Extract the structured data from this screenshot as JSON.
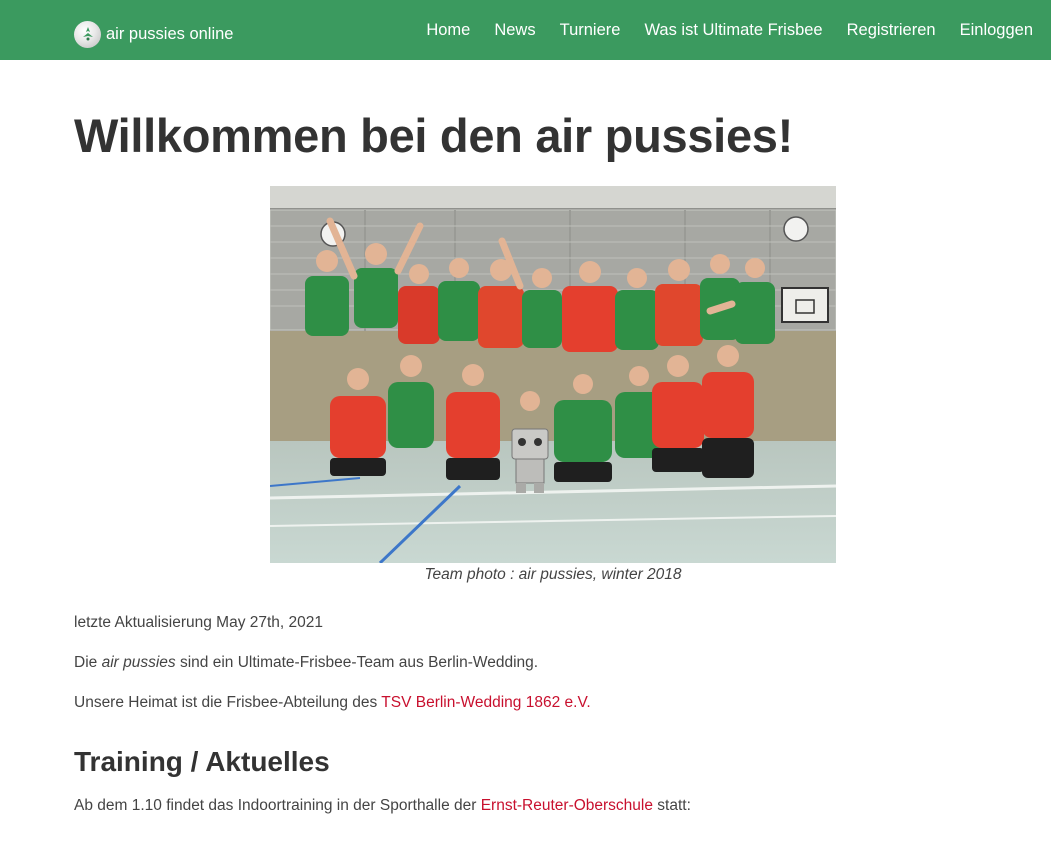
{
  "navbar": {
    "brand_label": "air pussies online",
    "items": [
      {
        "label": "Home"
      },
      {
        "label": "News"
      },
      {
        "label": "Turniere"
      },
      {
        "label": "Was ist Ultimate Frisbee"
      },
      {
        "label": "Registrieren"
      },
      {
        "label": "Einloggen"
      }
    ],
    "color": "#3b9a5f"
  },
  "main": {
    "title": "Willkommen bei den air pussies!",
    "photo_caption": "Team photo : air pussies, winter 2018",
    "last_update": "letzte Aktualisierung May 27th, 2021",
    "intro": {
      "before": "Die ",
      "team_name": "air pussies",
      "after": " sind ein Ultimate-Frisbee-Team aus Berlin-Wedding."
    },
    "home": {
      "before": "Unsere Heimat ist die Frisbee-Abteilung des ",
      "link": "TSV Berlin-Wedding 1862 e.V."
    },
    "section_title": "Training / Aktuelles",
    "training": {
      "before": "Ab dem 1.10 findet das Indoortraining in der Sporthalle der ",
      "link": "Ernst-Reuter-Oberschule",
      "after": " statt:"
    }
  },
  "colors": {
    "link": "#c8102e",
    "text": "#444444",
    "heading": "#333333"
  }
}
